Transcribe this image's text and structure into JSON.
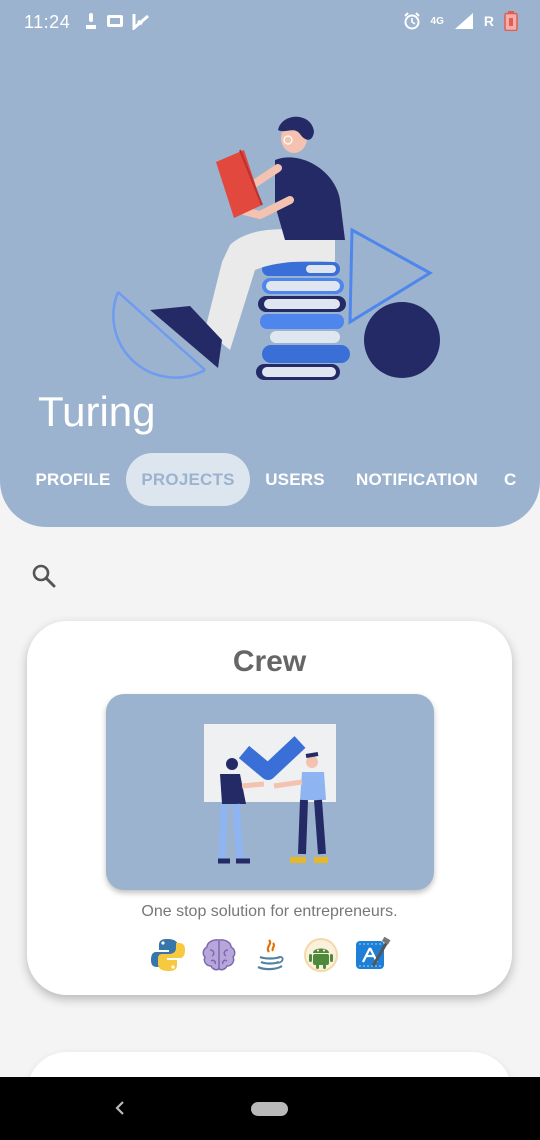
{
  "status_bar": {
    "time": "11:24",
    "right_text": "R",
    "network": "4G",
    "icons": [
      "data-usage-icon",
      "sim-card-icon",
      "check-notification-icon",
      "alarm-icon",
      "signal-icon",
      "battery-icon"
    ]
  },
  "header": {
    "title": "Turing",
    "background_color": "#9cb3cf",
    "hero_image": "person-reading-on-books-illustration"
  },
  "tabs": [
    {
      "label": "PROFILE",
      "active": false
    },
    {
      "label": "PROJECTS",
      "active": true
    },
    {
      "label": "USERS",
      "active": false
    },
    {
      "label": "NOTIFICATION",
      "active": false
    },
    {
      "label": "C",
      "active": false
    }
  ],
  "search": {
    "icon": "search-icon"
  },
  "projects": [
    {
      "title": "Crew",
      "image": "two-people-checkmark-illustration",
      "description": "One stop solution for entrepreneurs.",
      "tech": [
        "python-icon",
        "brain-icon",
        "java-icon",
        "android-icon",
        "xcode-icon"
      ]
    }
  ],
  "nav": {
    "back_icon": "back-icon",
    "home_icon": "home-pill-icon"
  }
}
